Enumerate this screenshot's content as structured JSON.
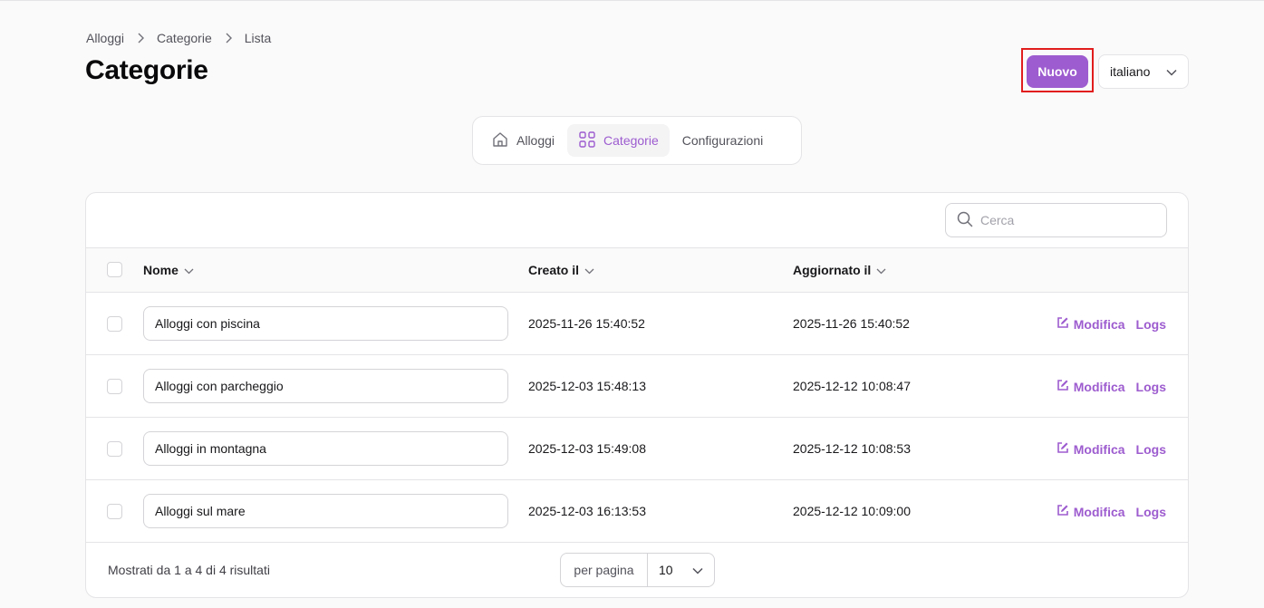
{
  "breadcrumb": [
    "Alloggi",
    "Categorie",
    "Lista"
  ],
  "page_title": "Categorie",
  "header": {
    "new_label": "Nuovo",
    "language": "italiano"
  },
  "tabs": [
    {
      "label": "Alloggi",
      "icon": "home-icon",
      "active": false
    },
    {
      "label": "Categorie",
      "icon": "grid-icon",
      "active": true
    },
    {
      "label": "Configurazioni",
      "icon": "",
      "active": false
    }
  ],
  "search": {
    "placeholder": "Cerca"
  },
  "table": {
    "columns": [
      "Nome",
      "Creato il",
      "Aggiornato il"
    ],
    "rows": [
      {
        "name": "Alloggi con piscina",
        "created": "2025-11-26 15:40:52",
        "updated": "2025-11-26 15:40:52"
      },
      {
        "name": "Alloggi con parcheggio",
        "created": "2025-12-03 15:48:13",
        "updated": "2025-12-12 10:08:47"
      },
      {
        "name": "Alloggi in montagna",
        "created": "2025-12-03 15:49:08",
        "updated": "2025-12-12 10:08:53"
      },
      {
        "name": "Alloggi sul mare",
        "created": "2025-12-03 16:13:53",
        "updated": "2025-12-12 10:09:00"
      }
    ],
    "edit_label": "Modifica",
    "logs_label": "Logs"
  },
  "footer": {
    "summary": "Mostrati da 1 a 4 di 4 risultati",
    "per_page_label": "per pagina",
    "per_page_value": "10"
  },
  "colors": {
    "accent": "#9d5ccf",
    "highlight": "#e11d1d"
  }
}
